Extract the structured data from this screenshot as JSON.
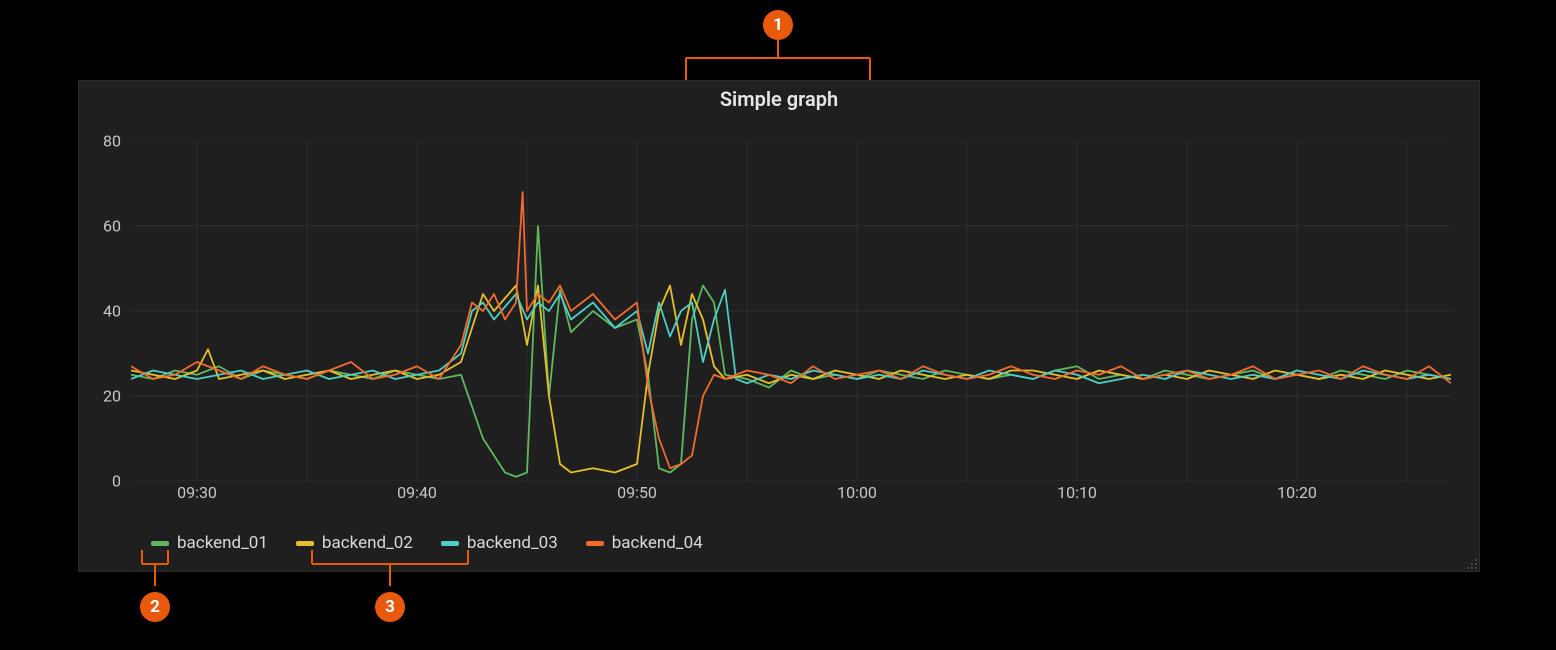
{
  "title": "Simple graph",
  "callouts": {
    "1": "1",
    "2": "2",
    "3": "3"
  },
  "legend": [
    {
      "name": "backend_01",
      "color": "#5eb95e"
    },
    {
      "name": "backend_02",
      "color": "#e6c02a"
    },
    {
      "name": "backend_03",
      "color": "#4ecdc4"
    },
    {
      "name": "backend_04",
      "color": "#f26a2e"
    }
  ],
  "chart_data": {
    "type": "line",
    "title": "Simple graph",
    "xlabel": "",
    "ylabel": "",
    "ylim": [
      0,
      80
    ],
    "xlim_minutes": [
      27,
      87
    ],
    "x_ticks": [
      "09:30",
      "09:40",
      "09:50",
      "10:00",
      "10:10",
      "10:20"
    ],
    "x_tick_minutes": [
      30,
      40,
      50,
      60,
      70,
      80
    ],
    "y_ticks": [
      0,
      20,
      40,
      60,
      80
    ],
    "series": [
      {
        "name": "backend_01",
        "color": "#5eb95e",
        "values": [
          [
            27,
            25
          ],
          [
            28,
            24
          ],
          [
            29,
            26
          ],
          [
            30,
            25
          ],
          [
            31,
            27
          ],
          [
            32,
            24
          ],
          [
            33,
            26
          ],
          [
            34,
            25
          ],
          [
            35,
            24
          ],
          [
            36,
            26
          ],
          [
            37,
            25
          ],
          [
            38,
            24
          ],
          [
            39,
            26
          ],
          [
            40,
            25
          ],
          [
            41,
            24
          ],
          [
            42,
            25
          ],
          [
            43,
            10
          ],
          [
            44,
            2
          ],
          [
            44.5,
            1
          ],
          [
            45,
            2
          ],
          [
            45.5,
            60
          ],
          [
            46,
            20
          ],
          [
            46.5,
            45
          ],
          [
            47,
            35
          ],
          [
            48,
            40
          ],
          [
            49,
            36
          ],
          [
            50,
            38
          ],
          [
            50.5,
            25
          ],
          [
            51,
            3
          ],
          [
            51.5,
            2
          ],
          [
            52,
            4
          ],
          [
            52.5,
            38
          ],
          [
            53,
            46
          ],
          [
            53.5,
            42
          ],
          [
            54,
            25
          ],
          [
            55,
            24
          ],
          [
            56,
            22
          ],
          [
            57,
            26
          ],
          [
            58,
            24
          ],
          [
            59,
            25
          ],
          [
            60,
            24
          ],
          [
            61,
            26
          ],
          [
            62,
            25
          ],
          [
            63,
            24
          ],
          [
            64,
            26
          ],
          [
            65,
            25
          ],
          [
            66,
            24
          ],
          [
            67,
            25
          ],
          [
            68,
            24
          ],
          [
            69,
            26
          ],
          [
            70,
            27
          ],
          [
            71,
            24
          ],
          [
            72,
            25
          ],
          [
            73,
            24
          ],
          [
            74,
            26
          ],
          [
            75,
            25
          ],
          [
            76,
            24
          ],
          [
            77,
            25
          ],
          [
            78,
            26
          ],
          [
            79,
            24
          ],
          [
            80,
            25
          ],
          [
            81,
            24
          ],
          [
            82,
            26
          ],
          [
            83,
            25
          ],
          [
            84,
            24
          ],
          [
            85,
            26
          ],
          [
            86,
            25
          ],
          [
            87,
            24
          ]
        ]
      },
      {
        "name": "backend_02",
        "color": "#e6c02a",
        "values": [
          [
            27,
            26
          ],
          [
            28,
            25
          ],
          [
            29,
            24
          ],
          [
            30,
            26
          ],
          [
            30.5,
            31
          ],
          [
            31,
            24
          ],
          [
            32,
            25
          ],
          [
            33,
            26
          ],
          [
            34,
            24
          ],
          [
            35,
            25
          ],
          [
            36,
            26
          ],
          [
            37,
            24
          ],
          [
            38,
            25
          ],
          [
            39,
            26
          ],
          [
            40,
            24
          ],
          [
            41,
            25
          ],
          [
            42,
            28
          ],
          [
            42.5,
            36
          ],
          [
            43,
            44
          ],
          [
            43.5,
            40
          ],
          [
            44,
            43
          ],
          [
            44.5,
            46
          ],
          [
            45,
            32
          ],
          [
            45.5,
            46
          ],
          [
            46,
            20
          ],
          [
            46.5,
            4
          ],
          [
            47,
            2
          ],
          [
            48,
            3
          ],
          [
            49,
            2
          ],
          [
            50,
            4
          ],
          [
            50.5,
            25
          ],
          [
            51,
            40
          ],
          [
            51.5,
            46
          ],
          [
            52,
            32
          ],
          [
            52.5,
            44
          ],
          [
            53,
            38
          ],
          [
            53.5,
            27
          ],
          [
            54,
            24
          ],
          [
            55,
            25
          ],
          [
            56,
            23
          ],
          [
            57,
            25
          ],
          [
            58,
            24
          ],
          [
            59,
            26
          ],
          [
            60,
            25
          ],
          [
            61,
            24
          ],
          [
            62,
            26
          ],
          [
            63,
            25
          ],
          [
            64,
            24
          ],
          [
            65,
            25
          ],
          [
            66,
            24
          ],
          [
            67,
            26
          ],
          [
            68,
            26
          ],
          [
            69,
            25
          ],
          [
            70,
            24
          ],
          [
            71,
            26
          ],
          [
            72,
            25
          ],
          [
            73,
            24
          ],
          [
            74,
            25
          ],
          [
            75,
            24
          ],
          [
            76,
            26
          ],
          [
            77,
            25
          ],
          [
            78,
            24
          ],
          [
            79,
            26
          ],
          [
            80,
            25
          ],
          [
            81,
            24
          ],
          [
            82,
            25
          ],
          [
            83,
            24
          ],
          [
            84,
            26
          ],
          [
            85,
            25
          ],
          [
            86,
            24
          ],
          [
            87,
            25
          ]
        ]
      },
      {
        "name": "backend_03",
        "color": "#4ecdc4",
        "values": [
          [
            27,
            24
          ],
          [
            28,
            26
          ],
          [
            29,
            25
          ],
          [
            30,
            24
          ],
          [
            31,
            25
          ],
          [
            32,
            26
          ],
          [
            33,
            24
          ],
          [
            34,
            25
          ],
          [
            35,
            26
          ],
          [
            36,
            24
          ],
          [
            37,
            25
          ],
          [
            38,
            26
          ],
          [
            39,
            24
          ],
          [
            40,
            25
          ],
          [
            41,
            26
          ],
          [
            42,
            30
          ],
          [
            42.5,
            40
          ],
          [
            43,
            42
          ],
          [
            43.5,
            38
          ],
          [
            44,
            41
          ],
          [
            44.5,
            44
          ],
          [
            45,
            38
          ],
          [
            45.5,
            42
          ],
          [
            46,
            40
          ],
          [
            46.5,
            44
          ],
          [
            47,
            38
          ],
          [
            48,
            42
          ],
          [
            49,
            36
          ],
          [
            50,
            40
          ],
          [
            50.5,
            30
          ],
          [
            51,
            42
          ],
          [
            51.5,
            34
          ],
          [
            52,
            40
          ],
          [
            52.5,
            42
          ],
          [
            53,
            28
          ],
          [
            53.5,
            38
          ],
          [
            54,
            45
          ],
          [
            54.5,
            24
          ],
          [
            55,
            23
          ],
          [
            56,
            25
          ],
          [
            57,
            24
          ],
          [
            58,
            26
          ],
          [
            59,
            25
          ],
          [
            60,
            24
          ],
          [
            61,
            25
          ],
          [
            62,
            24
          ],
          [
            63,
            26
          ],
          [
            64,
            25
          ],
          [
            65,
            24
          ],
          [
            66,
            26
          ],
          [
            67,
            25
          ],
          [
            68,
            24
          ],
          [
            69,
            26
          ],
          [
            70,
            25
          ],
          [
            71,
            23
          ],
          [
            72,
            24
          ],
          [
            73,
            25
          ],
          [
            74,
            24
          ],
          [
            75,
            26
          ],
          [
            76,
            25
          ],
          [
            77,
            24
          ],
          [
            78,
            25
          ],
          [
            79,
            24
          ],
          [
            80,
            26
          ],
          [
            81,
            25
          ],
          [
            82,
            24
          ],
          [
            83,
            26
          ],
          [
            84,
            25
          ],
          [
            85,
            24
          ],
          [
            86,
            25
          ],
          [
            87,
            24
          ]
        ]
      },
      {
        "name": "backend_04",
        "color": "#f26a2e",
        "values": [
          [
            27,
            27
          ],
          [
            28,
            24
          ],
          [
            29,
            25
          ],
          [
            30,
            28
          ],
          [
            31,
            26
          ],
          [
            32,
            24
          ],
          [
            33,
            27
          ],
          [
            34,
            25
          ],
          [
            35,
            24
          ],
          [
            36,
            26
          ],
          [
            37,
            28
          ],
          [
            38,
            24
          ],
          [
            39,
            25
          ],
          [
            40,
            27
          ],
          [
            41,
            24
          ],
          [
            42,
            32
          ],
          [
            42.5,
            42
          ],
          [
            43,
            40
          ],
          [
            43.5,
            44
          ],
          [
            44,
            38
          ],
          [
            44.5,
            42
          ],
          [
            44.8,
            68
          ],
          [
            45,
            40
          ],
          [
            45.5,
            44
          ],
          [
            46,
            42
          ],
          [
            46.5,
            46
          ],
          [
            47,
            40
          ],
          [
            48,
            44
          ],
          [
            49,
            38
          ],
          [
            50,
            42
          ],
          [
            50.5,
            22
          ],
          [
            51,
            10
          ],
          [
            51.5,
            3
          ],
          [
            52,
            4
          ],
          [
            52.5,
            6
          ],
          [
            53,
            20
          ],
          [
            53.5,
            25
          ],
          [
            54,
            24
          ],
          [
            55,
            26
          ],
          [
            56,
            25
          ],
          [
            57,
            23
          ],
          [
            58,
            27
          ],
          [
            59,
            24
          ],
          [
            60,
            25
          ],
          [
            61,
            26
          ],
          [
            62,
            24
          ],
          [
            63,
            27
          ],
          [
            64,
            25
          ],
          [
            65,
            24
          ],
          [
            66,
            25
          ],
          [
            67,
            27
          ],
          [
            68,
            25
          ],
          [
            69,
            24
          ],
          [
            70,
            26
          ],
          [
            71,
            25
          ],
          [
            72,
            27
          ],
          [
            73,
            24
          ],
          [
            74,
            25
          ],
          [
            75,
            26
          ],
          [
            76,
            24
          ],
          [
            77,
            25
          ],
          [
            78,
            27
          ],
          [
            79,
            24
          ],
          [
            80,
            25
          ],
          [
            81,
            26
          ],
          [
            82,
            24
          ],
          [
            83,
            27
          ],
          [
            84,
            25
          ],
          [
            85,
            24
          ],
          [
            86,
            27
          ],
          [
            87,
            23
          ]
        ]
      }
    ]
  }
}
